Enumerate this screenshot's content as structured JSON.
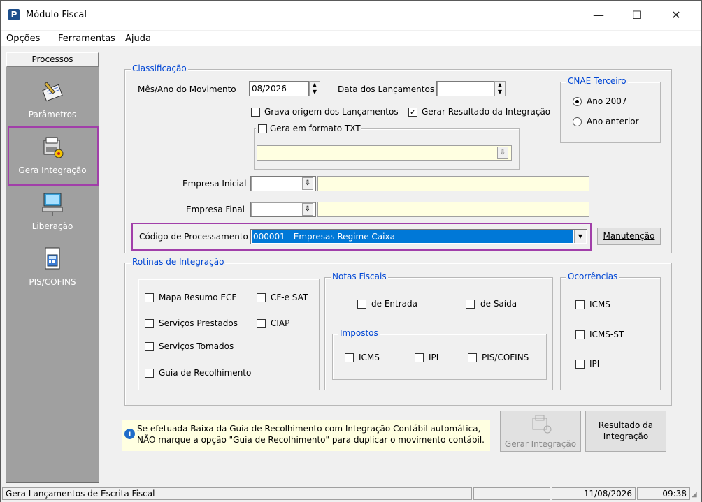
{
  "window": {
    "title": "Módulo Fiscal",
    "app_icon_letter": "P",
    "minimize": "—",
    "maximize": "☐",
    "close": "✕"
  },
  "menu": [
    "Opções",
    "Ferramentas",
    "Ajuda"
  ],
  "sidebar": {
    "header": "Processos",
    "items": [
      {
        "label": "Parâmetros",
        "icon": "pencil-notepad-icon"
      },
      {
        "label": "Gera Integração",
        "icon": "printer-gear-icon"
      },
      {
        "label": "Liberação",
        "icon": "computer-network-icon"
      },
      {
        "label": "PIS/COFINS",
        "icon": "document-calculator-icon"
      }
    ]
  },
  "classificacao": {
    "title": "Classificação",
    "mes_ano_label": "Mês/Ano do Movimento",
    "mes_ano_value": "08/2026",
    "data_lanc_label": "Data dos Lançamentos",
    "data_lanc_value": "",
    "grava_origem_label": "Grava origem dos Lançamentos",
    "grava_origem_checked": false,
    "gerar_resultado_label": "Gerar Resultado da Integração",
    "gerar_resultado_checked": true,
    "gera_txt_label": "Gera em formato TXT",
    "gera_txt_checked": false,
    "empresa_inicial_label": "Empresa Inicial",
    "empresa_final_label": "Empresa Final",
    "codigo_label": "Código de Processamento",
    "codigo_value": "000001 - Empresas Regime Caixa",
    "manutencao_button": "Manutenção"
  },
  "cnae": {
    "title": "CNAE Terceiro",
    "options": [
      {
        "label": "Ano 2007",
        "selected": true
      },
      {
        "label": "Ano anterior",
        "selected": false
      }
    ]
  },
  "rotinas": {
    "title": "Rotinas de Integração",
    "left": [
      {
        "label": "Mapa Resumo ECF",
        "checked": false
      },
      {
        "label": "Serviços Prestados",
        "checked": false
      },
      {
        "label": "Serviços Tomados",
        "checked": false
      },
      {
        "label": "Guia de Recolhimento",
        "checked": false
      }
    ],
    "middle": [
      {
        "label": "CF-e SAT",
        "checked": false
      },
      {
        "label": "CIAP",
        "checked": false
      }
    ],
    "notas": {
      "title": "Notas Fiscais",
      "items": [
        {
          "label": "de Entrada",
          "checked": false
        },
        {
          "label": "de Saída",
          "checked": false
        }
      ]
    },
    "impostos": {
      "title": "Impostos",
      "items": [
        {
          "label": "ICMS",
          "checked": false
        },
        {
          "label": "IPI",
          "checked": false
        },
        {
          "label": "PIS/COFINS",
          "checked": false
        }
      ]
    },
    "ocorrencias": {
      "title": "Ocorrências",
      "items": [
        {
          "label": "ICMS",
          "checked": false
        },
        {
          "label": "ICMS-ST",
          "checked": false
        },
        {
          "label": "IPI",
          "checked": false
        }
      ]
    }
  },
  "info": {
    "line1": "Se efetuada Baixa da Guia de Recolhimento com Integração Contábil automática,",
    "line2": "NÃO marque a opção \"Guia de Recolhimento\" para duplicar o movimento contábil."
  },
  "buttons": {
    "gerar": "Gerar Integração",
    "resultado_line1": "Resultado da",
    "resultado_line2": "Integração"
  },
  "status": {
    "text": "Gera Lançamentos de Escrita Fiscal",
    "date": "11/08/2026",
    "time": "09:38"
  },
  "colors": {
    "accent": "#0046d5",
    "highlight": "#a13fa9",
    "selection": "#0078d7",
    "sidebar_bg": "#a0a0a0",
    "info_bg": "#ffffe1"
  }
}
